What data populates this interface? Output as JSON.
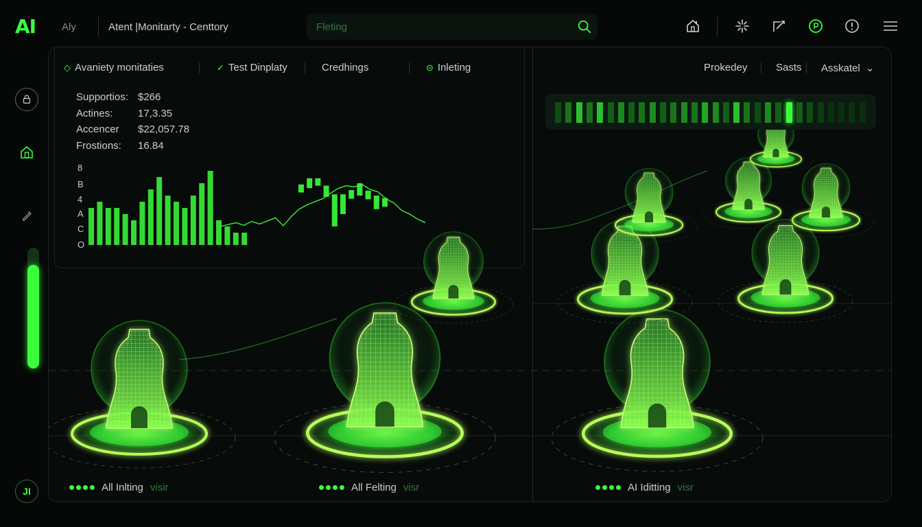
{
  "app": {
    "logo": "AI",
    "short_name": "Aly",
    "title": "Atent |Monitarty - Centtory"
  },
  "search": {
    "placeholder": "Fleting"
  },
  "toolbar_icons": [
    "home-icon",
    "sparkle-icon",
    "edit-icon",
    "power-icon",
    "alert-icon",
    "menu-icon"
  ],
  "rail": {
    "items": [
      "lock-icon",
      "house-icon",
      "pen-icon"
    ],
    "slider_level": 0.86,
    "bottom_label": "JI"
  },
  "panel_tabs": [
    {
      "label": "Avaniety monitaties",
      "icon": "diamond-icon"
    },
    {
      "label": "Test Dinplaty",
      "icon": "check-icon"
    },
    {
      "label": "Credhings",
      "icon": ""
    },
    {
      "label": "Inleting",
      "icon": "loop-icon"
    }
  ],
  "right_tabs": [
    {
      "label": "Prokedey"
    },
    {
      "label": "Sasts"
    },
    {
      "label": "Asskatel",
      "dropdown": true
    }
  ],
  "stats": [
    {
      "label": "Supportios:",
      "value": "$266"
    },
    {
      "label": "Actines:",
      "value": "17,3.35"
    },
    {
      "label": "Accencer",
      "value": "$22,057.78"
    },
    {
      "label": "Frostions:",
      "value": "16.84"
    }
  ],
  "chart_data": {
    "type": "bar",
    "ytick_labels": [
      "8",
      "B",
      "4",
      "A",
      "C",
      "O"
    ],
    "bars": [
      6,
      7,
      6,
      6,
      5,
      4,
      7,
      9,
      11,
      8,
      7,
      6,
      8,
      10,
      12,
      4,
      3,
      2,
      2
    ],
    "line": [
      3.0,
      3.3,
      3.6,
      3.2,
      3.8,
      3.4,
      3.9,
      4.4,
      3.1,
      4.6,
      5.8,
      6.5,
      7.0,
      7.5,
      8.4,
      9.2,
      9.6,
      9.4,
      9.8,
      9.0,
      8.6,
      7.5,
      6.8,
      5.6,
      5.0,
      4.2,
      3.6
    ],
    "candles": [
      {
        "open": 8.5,
        "close": 9.8
      },
      {
        "open": 9.2,
        "close": 10.8
      },
      {
        "open": 9.6,
        "close": 10.8
      },
      {
        "open": 7.8,
        "close": 9.6
      },
      {
        "open": 3.0,
        "close": 8.2
      },
      {
        "open": 5.0,
        "close": 8.2
      },
      {
        "open": 7.5,
        "close": 8.9
      },
      {
        "open": 8.0,
        "close": 10.0
      },
      {
        "open": 7.4,
        "close": 8.8
      },
      {
        "open": 5.8,
        "close": 8.0
      },
      {
        "open": 6.2,
        "close": 7.6
      }
    ],
    "accent": "#3cff3c"
  },
  "meter": {
    "levels": [
      0.3,
      0.5,
      0.8,
      0.5,
      0.8,
      0.4,
      0.6,
      0.4,
      0.5,
      0.6,
      0.4,
      0.5,
      0.6,
      0.5,
      0.7,
      0.6,
      0.4,
      0.8,
      0.5,
      0.3,
      0.6,
      0.4,
      1.0,
      0.4,
      0.3,
      0.2,
      0.1,
      0.1,
      0.1,
      0.1
    ]
  },
  "hologram_labels": [
    {
      "text": "All Inlting",
      "tag": "visir"
    },
    {
      "text": "All Felting",
      "tag": "visr"
    },
    {
      "text": "AI Iditting",
      "tag": "visr"
    }
  ],
  "colors": {
    "accent": "#3cff3c",
    "background": "#050807",
    "panel": "#070b09"
  }
}
